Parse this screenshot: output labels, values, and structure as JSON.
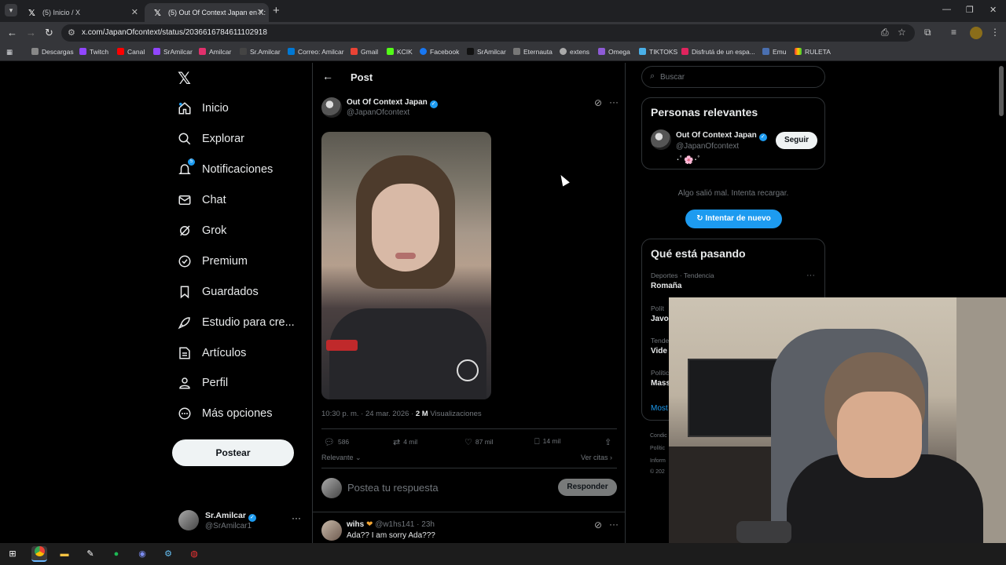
{
  "browser": {
    "tabs": [
      {
        "title": "(5) Inicio / X",
        "icon": "x-logo-icon"
      },
      {
        "title": "(5) Out Of Context Japan en X:",
        "icon": "x-logo-icon"
      }
    ],
    "url": "x.com/JapanOfcontext/status/2036616784611102918",
    "bookmarks": [
      "Descargas",
      "Twitch",
      "Canal",
      "SrAmilcar",
      "Amilcar",
      "Sr.Amilcar",
      "Correo: Amilcar",
      "Gmail",
      "KCIK",
      "Facebook",
      "SrAmilcar",
      "Eternauta",
      "extens",
      "Omega",
      "TIKTOKS",
      "Disfrutá de un espa...",
      "Emu",
      "RULETA"
    ]
  },
  "nav": {
    "items": [
      {
        "label": "Inicio",
        "icon": "home-icon"
      },
      {
        "label": "Explorar",
        "icon": "search-icon"
      },
      {
        "label": "Notificaciones",
        "icon": "bell-icon",
        "badge": "5"
      },
      {
        "label": "Chat",
        "icon": "mail-icon"
      },
      {
        "label": "Grok",
        "icon": "grok-icon"
      },
      {
        "label": "Premium",
        "icon": "verified-icon"
      },
      {
        "label": "Guardados",
        "icon": "bookmark-icon"
      },
      {
        "label": "Estudio para cre...",
        "icon": "rocket-icon"
      },
      {
        "label": "Artículos",
        "icon": "article-icon"
      },
      {
        "label": "Perfil",
        "icon": "person-icon"
      },
      {
        "label": "Más opciones",
        "icon": "more-circle-icon"
      }
    ],
    "post_button": "Postear",
    "account": {
      "name": "Sr.Amilcar",
      "handle": "@SrAmilcar1"
    }
  },
  "post": {
    "header": "Post",
    "author": {
      "name": "Out Of Context Japan",
      "handle": "@JapanOfcontext"
    },
    "timestamp": "10:30 p. m. · 24 mar. 2026 · ",
    "views_count": "2 M",
    "views_label": " Visualizaciones",
    "stats": {
      "replies": "586",
      "reposts": "4 mil",
      "likes": "87 mil",
      "bookmarks": "14 mil"
    },
    "sort_label": "Relevante",
    "quotes_label": "Ver citas",
    "reply_placeholder": "Postea tu respuesta",
    "reply_button": "Responder"
  },
  "comment": {
    "name": "wihs",
    "handle": "@w1hs141 · 23h",
    "text": "Ada?? I am sorry Ada???"
  },
  "right": {
    "search_placeholder": "Buscar",
    "relevant_title": "Personas relevantes",
    "relevant": {
      "name": "Out Of Context Japan",
      "handle": "@JapanOfcontext",
      "bio": "･ﾟ🌸･ﾟ",
      "follow": "Seguir"
    },
    "error_text": "Algo salió mal. Intenta recargar.",
    "retry": "Intentar de nuevo",
    "trends_title": "Qué está pasando",
    "trends": [
      {
        "category": "Deportes · Tendencia",
        "name": "Romaña"
      },
      {
        "category": "Polít",
        "name": "Javo"
      },
      {
        "category": "Tende",
        "name": "Vide"
      },
      {
        "category": "Polític",
        "name": "Mass"
      }
    ],
    "show_more": "Most",
    "footer": [
      "Condic",
      "Polític",
      "Inform",
      "© 202"
    ]
  },
  "colors": {
    "accent": "#1d9bf0",
    "bg": "#000000",
    "border": "#2f3336",
    "muted": "#71767b"
  }
}
